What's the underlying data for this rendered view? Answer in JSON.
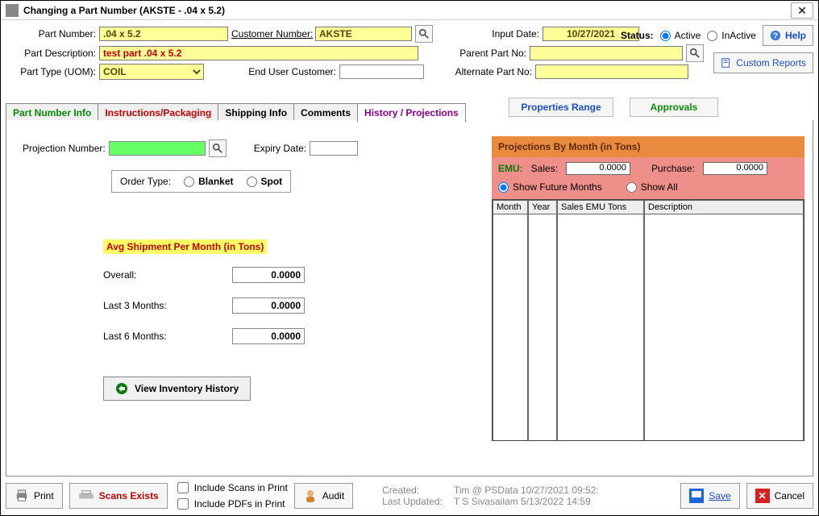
{
  "window": {
    "title": "Changing a Part Number  (AKSTE - .04 x 5.2)"
  },
  "status": {
    "label": "Status:",
    "active": "Active",
    "inactive": "InActive"
  },
  "help": {
    "label": "Help"
  },
  "customReports": {
    "label": "Custom Reports"
  },
  "topform": {
    "partNumber": {
      "label": "Part Number:",
      "value": ".04 x 5.2"
    },
    "customerNumber": {
      "label": "Customer Number:",
      "value": "AKSTE"
    },
    "inputDate": {
      "label": "Input Date:",
      "value": "10/27/2021"
    },
    "partDesc": {
      "label": "Part Description:",
      "value": "test part .04 x 5.2"
    },
    "parentPartNo": {
      "label": "Parent Part No:",
      "value": ""
    },
    "partType": {
      "label": "Part Type (UOM):",
      "value": "COIL"
    },
    "endUserCust": {
      "label": "End User Customer:",
      "value": ""
    },
    "altPartNo": {
      "label": "Alternate Part No:",
      "value": ""
    }
  },
  "actions": {
    "propertiesRange": "Properties Range",
    "approvals": "Approvals"
  },
  "tabs": {
    "t1": "Part Number Info",
    "t2": "Instructions/Packaging",
    "t3": "Shipping Info",
    "t4": "Comments",
    "t5": "History / Projections"
  },
  "hist": {
    "projNum": {
      "label": "Projection Number:",
      "value": ""
    },
    "expiry": {
      "label": "Expiry Date:",
      "value": ""
    },
    "orderType": {
      "label": "Order Type:",
      "blanket": "Blanket",
      "spot": "Spot"
    },
    "avgTitle": "Avg Shipment Per Month (in Tons)",
    "overall": {
      "label": "Overall:",
      "value": "0.0000"
    },
    "last3": {
      "label": "Last 3 Months:",
      "value": "0.0000"
    },
    "last6": {
      "label": "Last 6 Months:",
      "value": "0.0000"
    },
    "viewInv": "View Inventory History"
  },
  "proj": {
    "title": "Projections By Month (in Tons)",
    "emu": "EMU:",
    "salesLbl": "Sales:",
    "salesVal": "0.0000",
    "purchLbl": "Purchase:",
    "purchVal": "0.0000",
    "showFuture": "Show Future Months",
    "showAll": "Show All",
    "cols": {
      "c1": "Month",
      "c2": "Year",
      "c3": "Sales EMU Tons",
      "c4": "Description"
    }
  },
  "footer": {
    "print": "Print",
    "scans": "Scans Exists",
    "includeScans": "Include Scans in Print",
    "includePdfs": "Include PDFs in Print",
    "audit": "Audit",
    "createdLbl": "Created:",
    "createdVal": "Tim @ PSData 10/27/2021 09:52:",
    "updatedLbl": "Last Updated:",
    "updatedVal": "T S Sivasailam 5/13/2022 14:59",
    "save": "Save",
    "cancel": "Cancel"
  }
}
